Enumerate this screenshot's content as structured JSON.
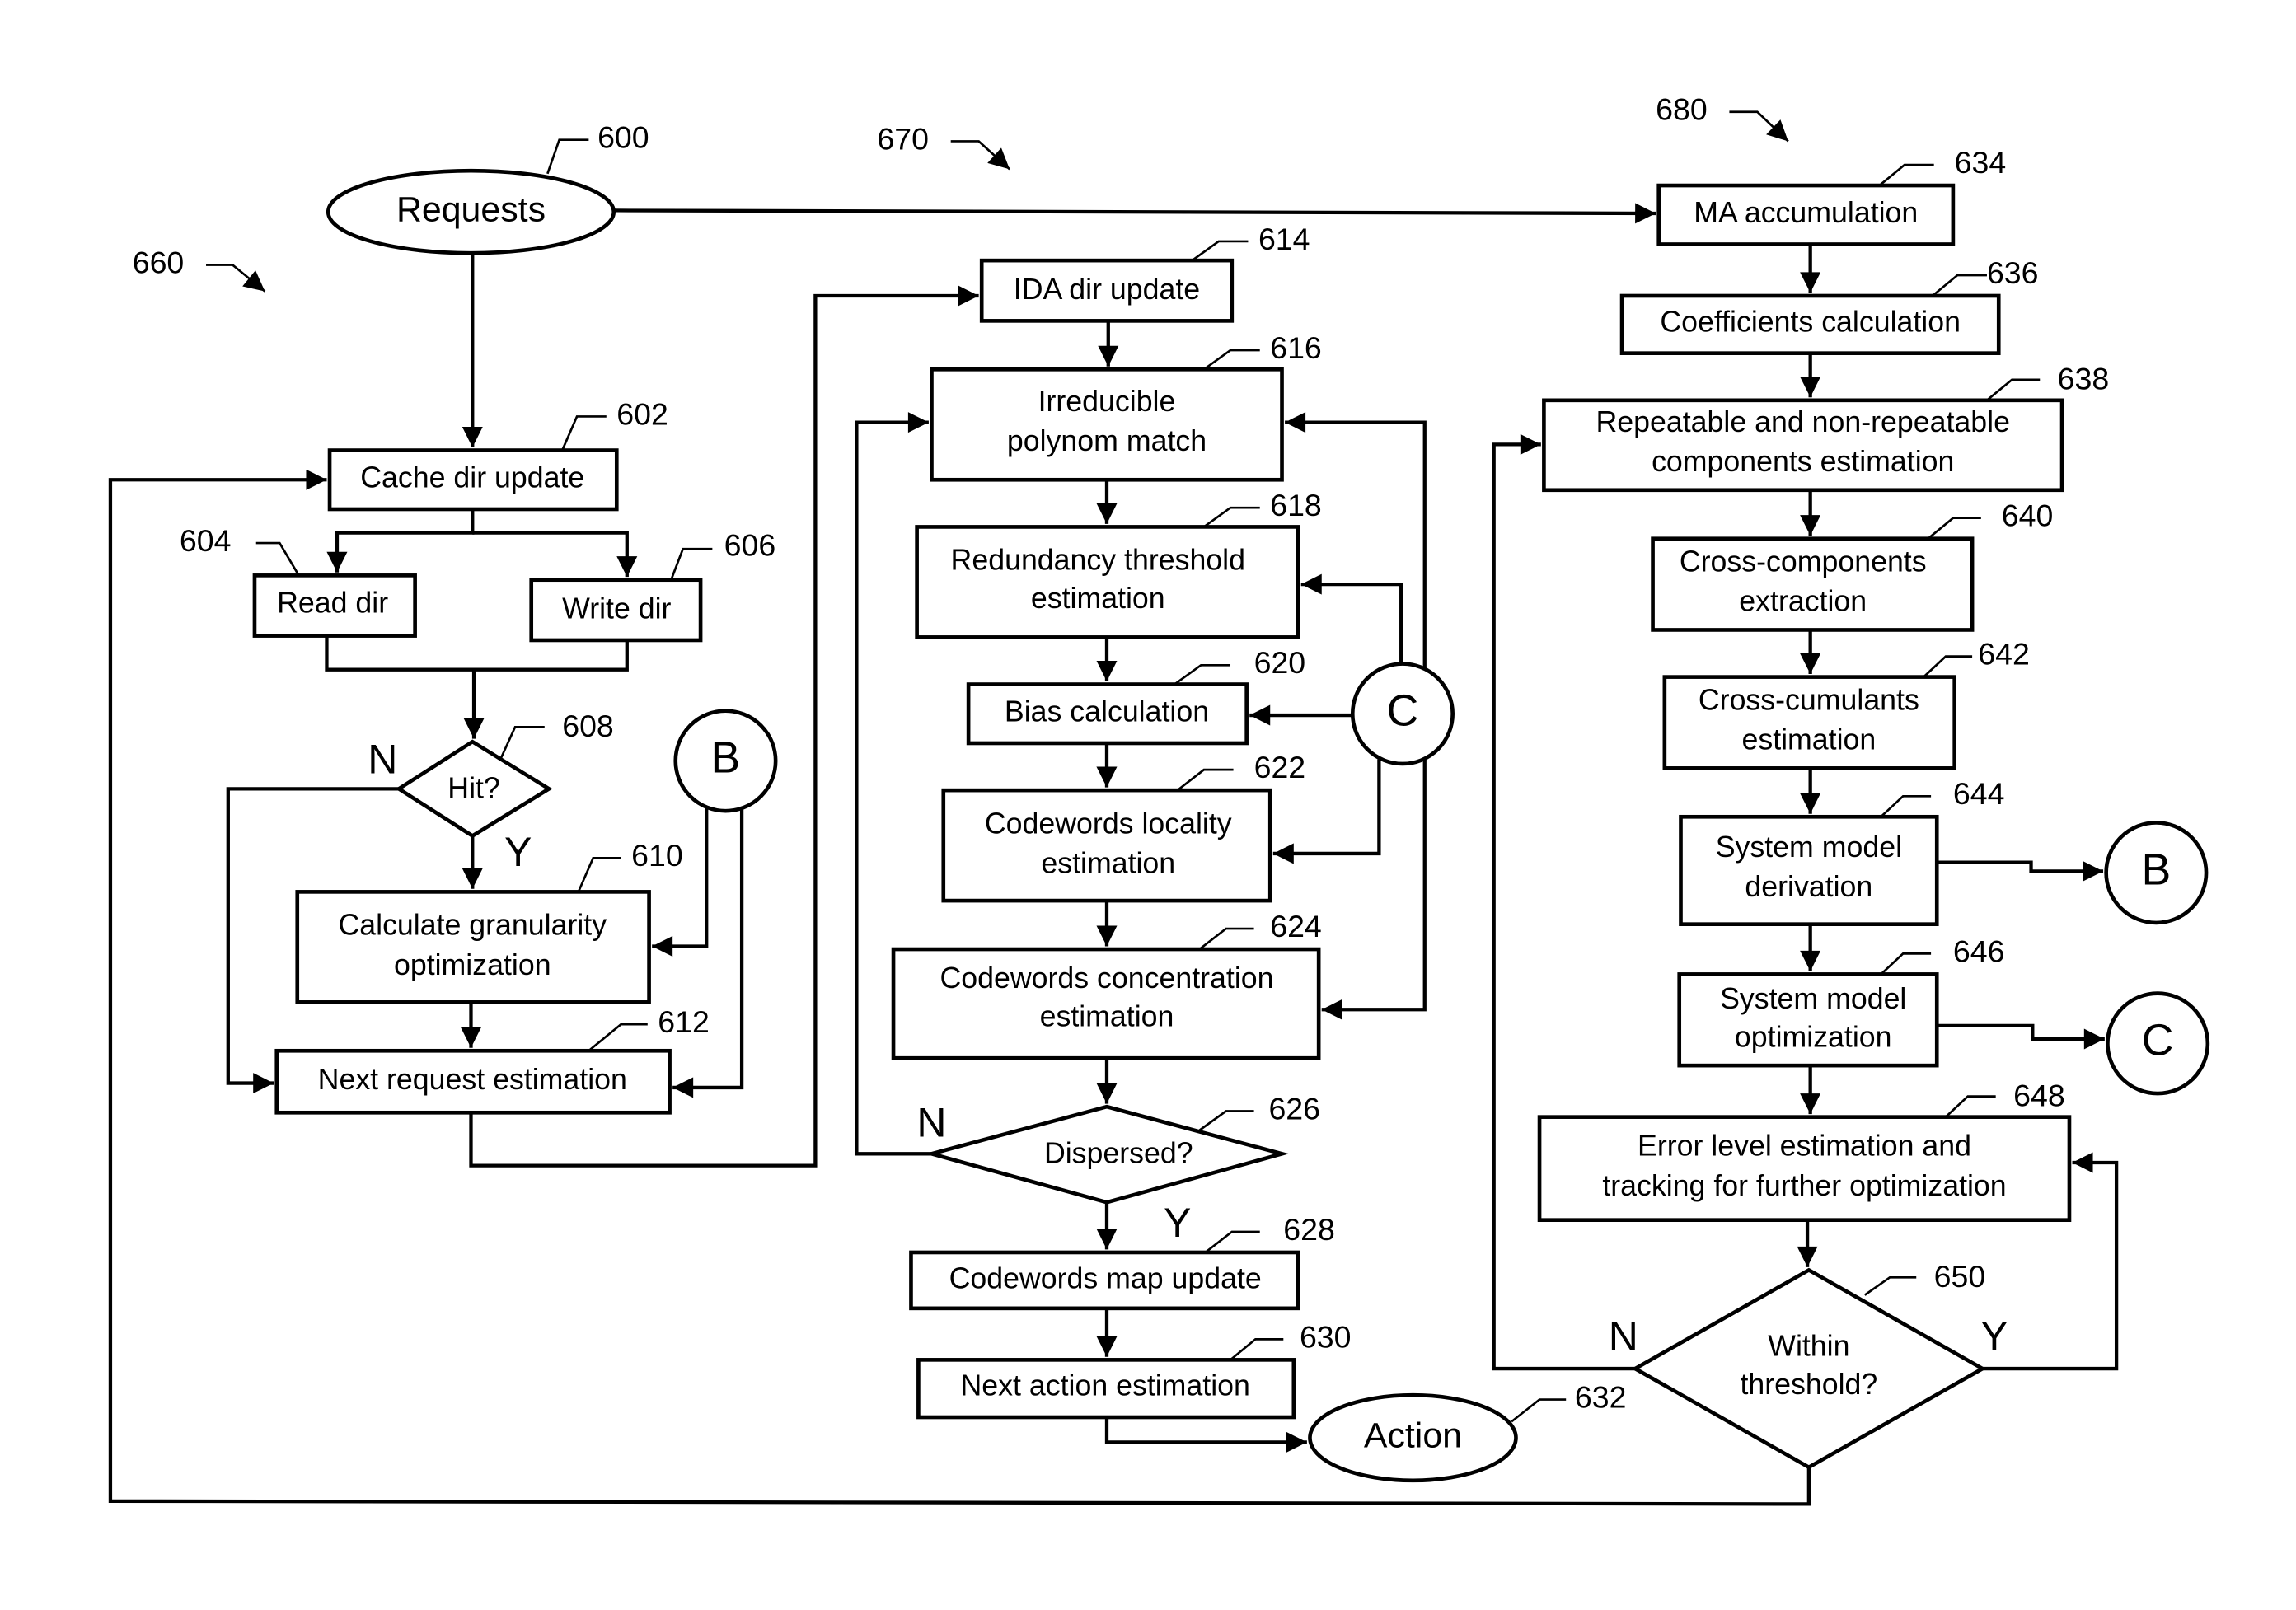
{
  "figure": {
    "group_labels": {
      "g660": "660",
      "g670": "670",
      "g680": "680"
    },
    "terminals": {
      "requests": {
        "label": "Requests",
        "ref": "600"
      },
      "action": {
        "label": "Action",
        "ref": "632"
      }
    },
    "column_660": {
      "cache_dir_update": {
        "label": "Cache dir update",
        "ref": "602"
      },
      "read_dir": {
        "label": "Read dir",
        "ref": "604"
      },
      "write_dir": {
        "label": "Write dir",
        "ref": "606"
      },
      "hit_decision": {
        "label": "Hit?",
        "ref": "608",
        "no": "N",
        "yes": "Y"
      },
      "calc_granularity": {
        "line1": "Calculate granularity",
        "line2": "optimization",
        "ref": "610"
      },
      "next_request": {
        "label": "Next request estimation",
        "ref": "612"
      },
      "connector_b": "B"
    },
    "column_670": {
      "ida_dir_update": {
        "label": "IDA dir update",
        "ref": "614"
      },
      "irreducible": {
        "line1": "Irreducible",
        "line2": "polynom match",
        "ref": "616"
      },
      "redundancy": {
        "line1": "Redundancy threshold",
        "line2": "estimation",
        "ref": "618"
      },
      "bias": {
        "label": "Bias calculation",
        "ref": "620"
      },
      "locality": {
        "line1": "Codewords locality",
        "line2": "estimation",
        "ref": "622"
      },
      "concentration": {
        "line1": "Codewords concentration",
        "line2": "estimation",
        "ref": "624"
      },
      "dispersed": {
        "label": "Dispersed?",
        "ref": "626",
        "no": "N",
        "yes": "Y"
      },
      "map_update": {
        "label": "Codewords map update",
        "ref": "628"
      },
      "next_action": {
        "label": "Next action estimation",
        "ref": "630"
      },
      "connector_c": "C"
    },
    "column_680": {
      "ma_accumulation": {
        "label": "MA accumulation",
        "ref": "634"
      },
      "coefficients": {
        "label": "Coefficients calculation",
        "ref": "636"
      },
      "repeatable": {
        "line1": "Repeatable and non-repeatable",
        "line2": "components estimation",
        "ref": "638"
      },
      "cross_components": {
        "line1": "Cross-components",
        "line2": "extraction",
        "ref": "640"
      },
      "cross_cumulants": {
        "line1": "Cross-cumulants",
        "line2": "estimation",
        "ref": "642"
      },
      "model_derivation": {
        "line1": "System model",
        "line2": "derivation",
        "ref": "644"
      },
      "model_optimization": {
        "line1": "System model",
        "line2": "optimization",
        "ref": "646"
      },
      "error_level": {
        "line1": "Error level estimation and",
        "line2": "tracking for further optimization",
        "ref": "648"
      },
      "within_threshold": {
        "line1": "Within",
        "line2": "threshold?",
        "ref": "650",
        "no": "N",
        "yes": "Y"
      },
      "connector_b": "B",
      "connector_c": "C"
    }
  }
}
